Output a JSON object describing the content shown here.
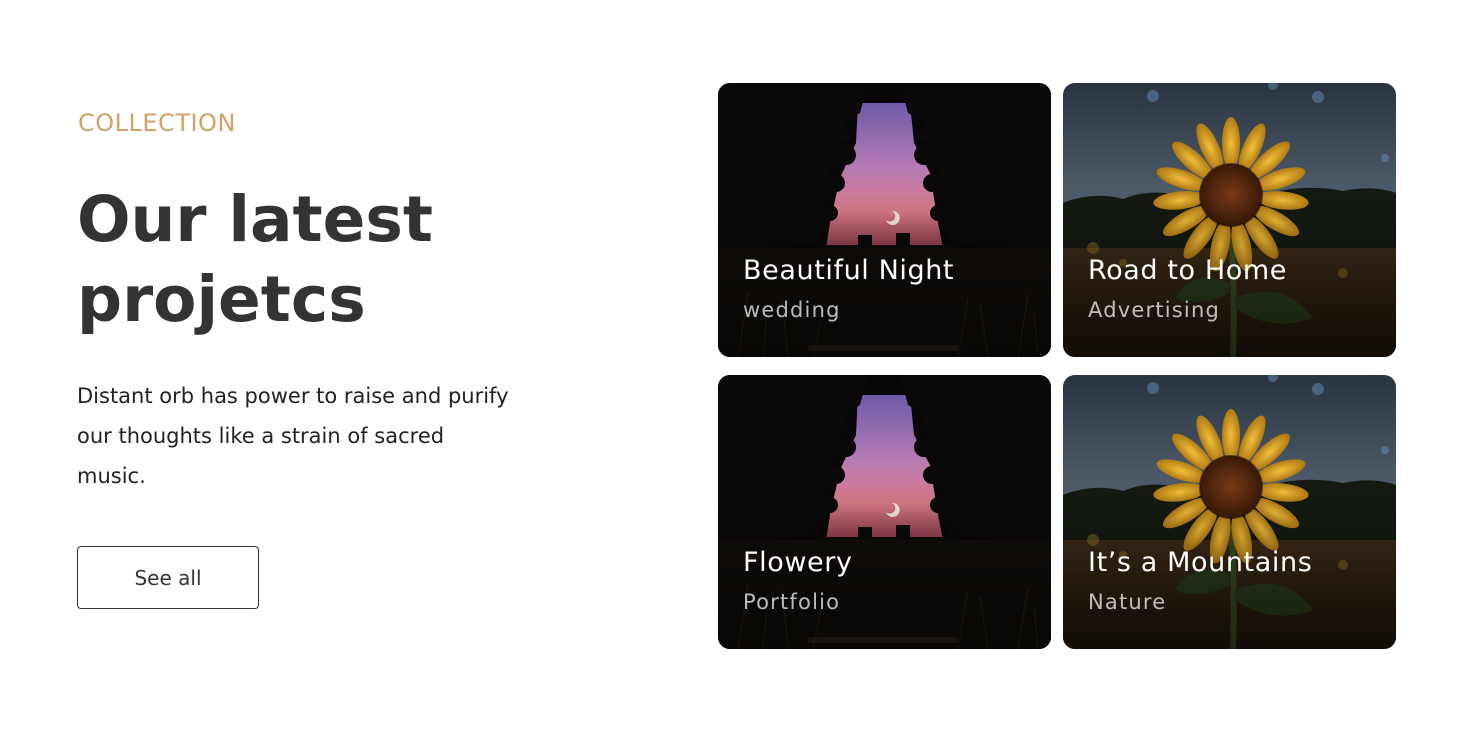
{
  "section": {
    "eyebrow": "COLLECTION",
    "title_line1": "Our latest",
    "title_line2": "projetcs",
    "description": "Distant orb has power to raise and purify our thoughts like a strain of sacred music.",
    "button_label": "See all"
  },
  "colors": {
    "accent": "#d2a266",
    "heading": "#333333",
    "text": "#222222"
  },
  "cards": [
    {
      "title": "Beautiful Night",
      "subtitle": "wedding",
      "image": "night-silhouette-image"
    },
    {
      "title": "Road to Home",
      "subtitle": "Advertising",
      "image": "sunflower-image"
    },
    {
      "title": "Flowery",
      "subtitle": "Portfolio",
      "image": "night-silhouette-image"
    },
    {
      "title": "It’s a Mountains",
      "subtitle": "Nature",
      "image": "sunflower-image"
    }
  ]
}
